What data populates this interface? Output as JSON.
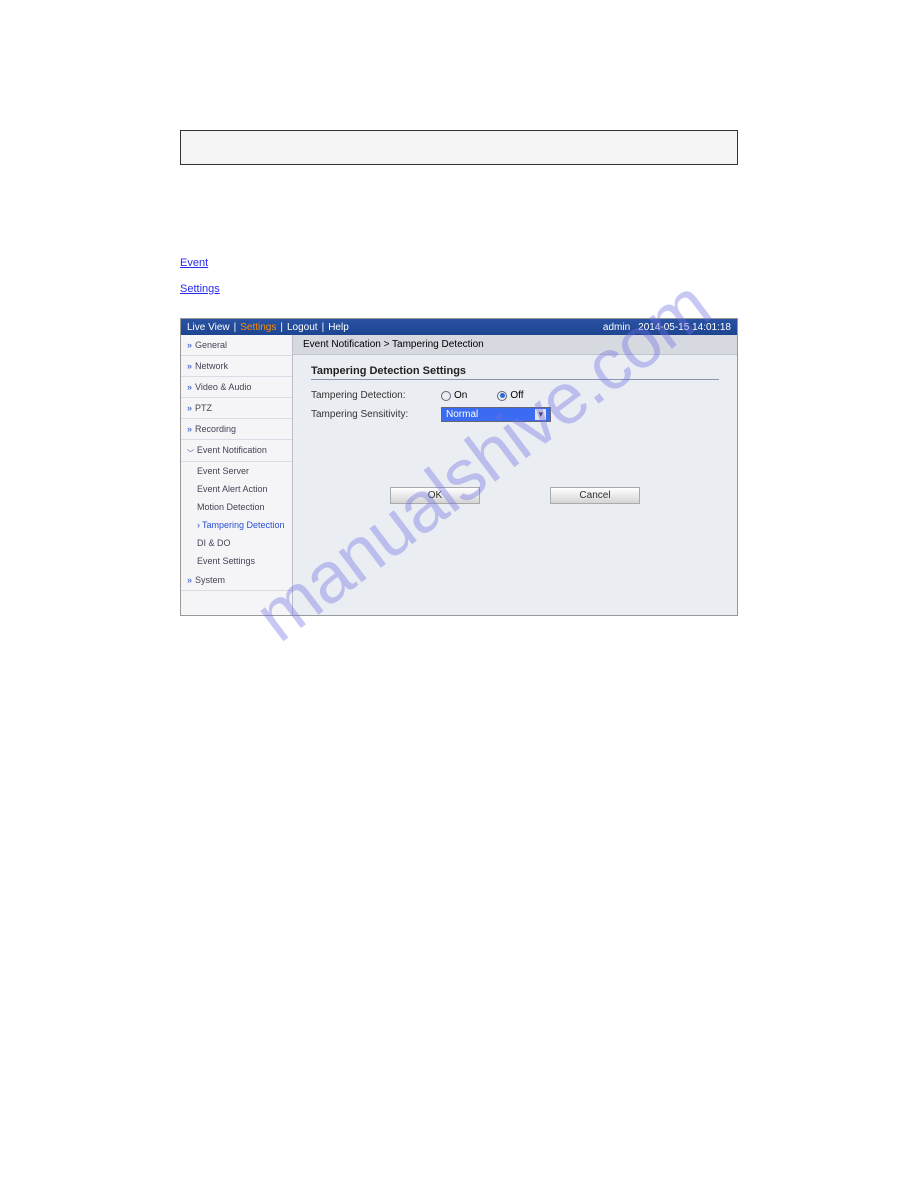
{
  "watermark": "manualshive.com",
  "para1_link": "Event",
  "para2_link": "Settings",
  "topnav": {
    "links": [
      "Live View",
      "Settings",
      "Logout",
      "Help"
    ],
    "user": "admin",
    "datetime": "2014-05-15  14:01:18"
  },
  "sidebar": {
    "groups": [
      "General",
      "Network",
      "Video & Audio",
      "PTZ",
      "Recording"
    ],
    "expanded": "Event Notification",
    "subs": [
      "Event Server",
      "Event Alert Action",
      "Motion Detection",
      "Tampering Detection",
      "DI & DO",
      "Event Settings"
    ],
    "active_sub": "Tampering Detection",
    "last_group": "System"
  },
  "main": {
    "crumb": "Event Notification > Tampering Detection",
    "section_title": "Tampering Detection Settings",
    "row1_label": "Tampering Detection:",
    "radio_on": "On",
    "radio_off": "Off",
    "row2_label": "Tampering Sensitivity:",
    "select_value": "Normal",
    "ok": "OK",
    "cancel": "Cancel"
  }
}
